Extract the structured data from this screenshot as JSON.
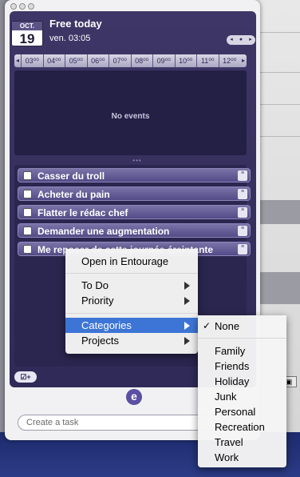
{
  "header": {
    "date_month": "OCT.",
    "date_day": "19",
    "title": "Free today",
    "subtitle": "ven. 03:05",
    "nav_prev": "◂",
    "nav_today": "●",
    "nav_next": "▸"
  },
  "timeline": {
    "scroll_left": "◂",
    "scroll_right": "▸",
    "hours": [
      "03⁰⁰",
      "04⁰⁰",
      "05⁰⁰",
      "06⁰⁰",
      "07⁰⁰",
      "08⁰⁰",
      "09⁰⁰",
      "10⁰⁰",
      "11⁰⁰",
      "12⁰⁰"
    ]
  },
  "events": {
    "empty_text": "No events",
    "divider": "•••"
  },
  "tasks": [
    {
      "label": "Casser du troll"
    },
    {
      "label": "Acheter du pain"
    },
    {
      "label": "Flatter le rédac chef"
    },
    {
      "label": "Demander une augmentation"
    },
    {
      "label": "Me reposer de cette journée éreintante"
    }
  ],
  "footer": {
    "add_task_label": "☑+",
    "logo": "e",
    "create_task_placeholder": "Create a task"
  },
  "context_menu": {
    "open": "Open in Entourage",
    "todo": "To Do",
    "priority": "Priority",
    "categories": "Categories",
    "projects": "Projects"
  },
  "categories_submenu": {
    "checkmark": "✓",
    "none": "None",
    "items": [
      "Family",
      "Friends",
      "Holiday",
      "Junk",
      "Personal",
      "Recreation",
      "Travel",
      "Work"
    ]
  },
  "colors": {
    "panel": "#2f2a58",
    "task_bar": "#6b64a0",
    "menu_highlight": "#3d75d6"
  }
}
